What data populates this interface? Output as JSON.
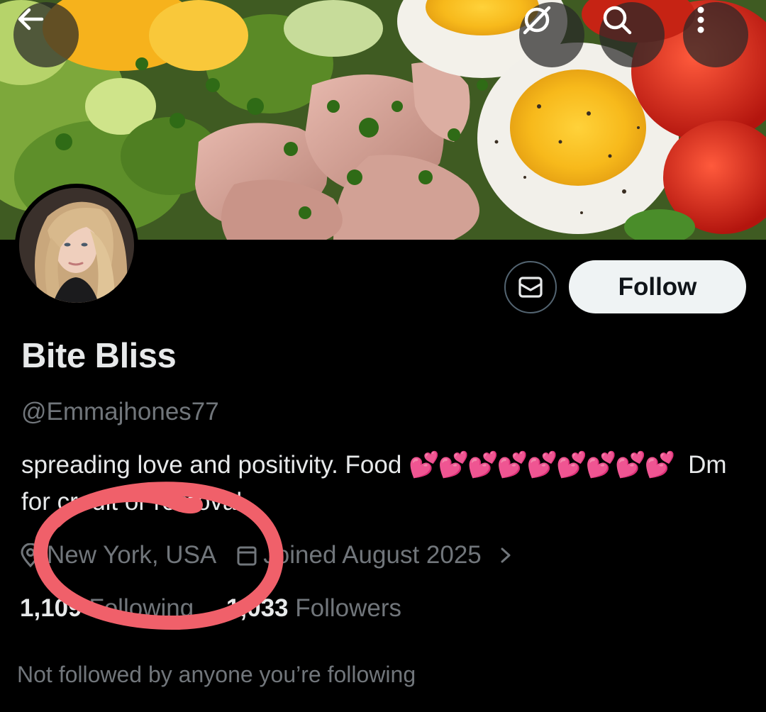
{
  "header": {
    "back_icon": "arrow-left-icon",
    "grok_icon": "grok-icon",
    "search_icon": "search-icon",
    "more_icon": "more-vertical-icon"
  },
  "profile": {
    "display_name": "Bite Bliss",
    "handle": "@Emmajhones77",
    "bio_line1_text": "spreading love and positivity. Food",
    "bio_line2_text": "Dm for credit or removal.",
    "heart_emoji": "💕",
    "location": "New York, USA",
    "joined": "Joined August 2025",
    "following_count": "1,109",
    "following_label": "Following",
    "followers_count": "1,033",
    "followers_label": "Followers",
    "not_followed": "Not followed by anyone you’re following"
  },
  "actions": {
    "follow_label": "Follow",
    "message_icon": "mail-icon"
  },
  "colors": {
    "background": "#000000",
    "primary_text": "#e7e9ea",
    "secondary_text": "#71767b",
    "follow_button_bg": "#eff3f4",
    "annotation_circle": "#f0606a",
    "heart_pink": "#f04c9a"
  }
}
